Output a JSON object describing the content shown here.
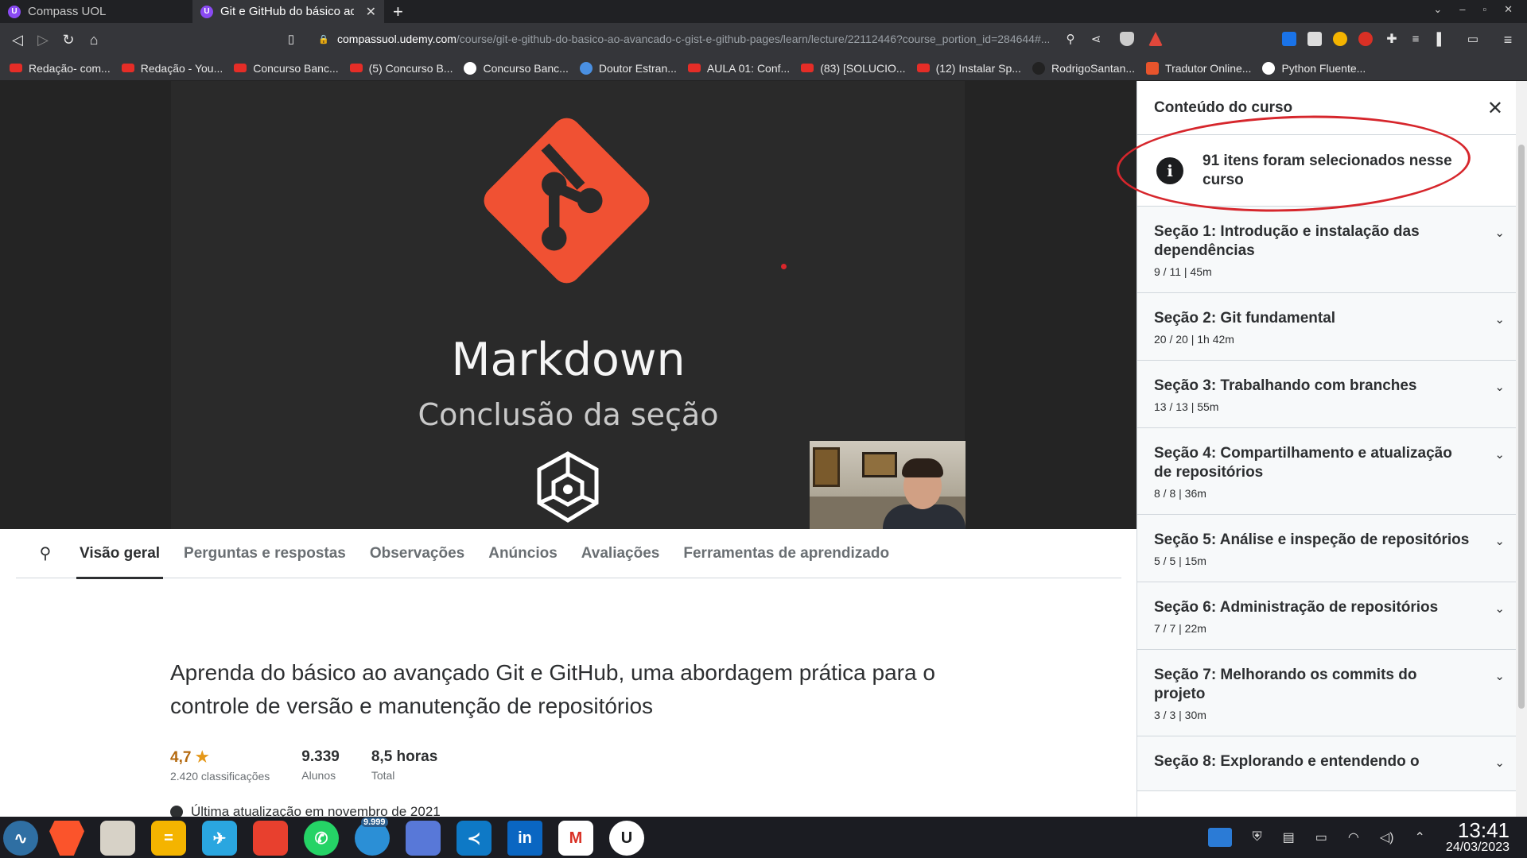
{
  "browser": {
    "tabs": [
      {
        "title": "Compass UOL",
        "icon": "udemy-favicon",
        "active": false
      },
      {
        "title": "Git e GitHub do básico ao a",
        "icon": "udemy-favicon",
        "active": true
      }
    ],
    "new_tab": "+",
    "url_domain": "compassuol.udemy.com",
    "url_path": "/course/git-e-github-do-basico-ao-avancado-c-gist-e-github-pages/learn/lecture/22112446?course_portion_id=284644#...",
    "bookmarks": [
      {
        "label": "Redação- com...",
        "icon": "youtube-icon"
      },
      {
        "label": "Redação - You...",
        "icon": "youtube-icon"
      },
      {
        "label": "Concurso Banc...",
        "icon": "youtube-icon"
      },
      {
        "label": "(5) Concurso B...",
        "icon": "youtube-icon"
      },
      {
        "label": "Concurso Banc...",
        "icon": "bookmark-icon"
      },
      {
        "label": "Doutor Estran...",
        "icon": "site-icon"
      },
      {
        "label": "AULA 01: Conf...",
        "icon": "youtube-icon"
      },
      {
        "label": "(83) [SOLUCIO...",
        "icon": "youtube-icon"
      },
      {
        "label": "(12) Instalar Sp...",
        "icon": "youtube-icon"
      },
      {
        "label": "RodrigoSantan...",
        "icon": "github-icon"
      },
      {
        "label": "Tradutor Online...",
        "icon": "translate-icon"
      },
      {
        "label": "Python Fluente...",
        "icon": "globe-icon"
      }
    ]
  },
  "video": {
    "slide_title": "Markdown",
    "slide_subtitle": "Conclusão da seção"
  },
  "content_tabs": [
    {
      "label": "Visão geral",
      "active": true
    },
    {
      "label": "Perguntas e respostas",
      "active": false
    },
    {
      "label": "Observações",
      "active": false
    },
    {
      "label": "Anúncios",
      "active": false
    },
    {
      "label": "Avaliações",
      "active": false
    },
    {
      "label": "Ferramentas de aprendizado",
      "active": false
    }
  ],
  "overview": {
    "headline": "Aprenda do básico ao avançado Git e GitHub, uma abordagem prática para o controle de versão e manutenção de repositórios",
    "rating_value": "4,7",
    "rating_star": "★",
    "rating_label": "2.420 classificações",
    "students_value": "9.339",
    "students_label": "Alunos",
    "hours_value": "8,5 horas",
    "hours_label": "Total",
    "last_update": "Última atualização em novembro de 2021"
  },
  "sidebar": {
    "title": "Conteúdo do curso",
    "info": "91 itens foram selecionados nesse curso",
    "sections": [
      {
        "title": "Seção 1: Introdução e instalação das dependências",
        "meta": "9 / 11 | 45m"
      },
      {
        "title": "Seção 2: Git fundamental",
        "meta": "20 / 20 | 1h 42m"
      },
      {
        "title": "Seção 3: Trabalhando com branches",
        "meta": "13 / 13 | 55m"
      },
      {
        "title": "Seção 4: Compartilhamento e atualização de repositórios",
        "meta": "8 / 8 | 36m"
      },
      {
        "title": "Seção 5: Análise e inspeção de repositórios",
        "meta": "5 / 5 | 15m"
      },
      {
        "title": "Seção 6: Administração de repositórios",
        "meta": "7 / 7 | 22m"
      },
      {
        "title": "Seção 7: Melhorando os commits do projeto",
        "meta": "3 / 3 | 30m"
      },
      {
        "title": "Seção 8: Explorando e entendendo o",
        "meta": ""
      }
    ]
  },
  "taskbar": {
    "badge_count": "9.999",
    "time": "13:41",
    "date": "24/03/2023"
  },
  "colors": {
    "git_orange": "#f05133",
    "udemy_purple": "#8a4af3",
    "annotation_red": "#d6262c",
    "rating_orange": "#b4690e"
  }
}
